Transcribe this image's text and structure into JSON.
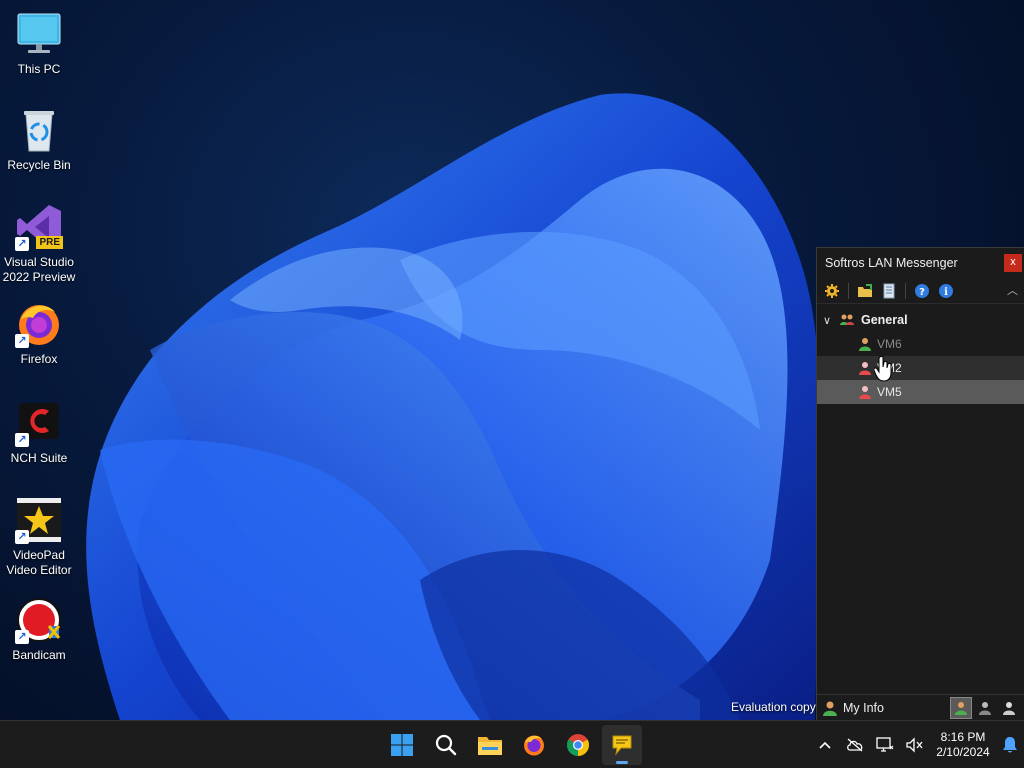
{
  "desktop": {
    "icons": [
      {
        "label": "This PC"
      },
      {
        "label": "Recycle Bin"
      },
      {
        "label": "Visual Studio 2022 Preview",
        "badge": "PRE"
      },
      {
        "label": "Firefox"
      },
      {
        "label": "NCH Suite"
      },
      {
        "label": "VideoPad Video Editor"
      },
      {
        "label": "Bandicam"
      }
    ],
    "evaluation_text": "Evaluation copy"
  },
  "messenger": {
    "title": "Softros LAN Messenger",
    "close_label": "x",
    "toolbar_icons": [
      "settings-icon",
      "send-files-icon",
      "message-log-icon",
      "help-icon",
      "info-icon"
    ],
    "groups": [
      {
        "label": "General",
        "contacts": [
          {
            "name": "VM6",
            "state": "offline"
          },
          {
            "name": "VM2",
            "state": "hover"
          },
          {
            "name": "VM5",
            "state": "selected"
          }
        ]
      }
    ],
    "my_info_label": "My Info",
    "accent": "#c42b1c"
  },
  "taskbar": {
    "apps": [
      "start-icon",
      "search-icon",
      "file-explorer-icon",
      "firefox-icon",
      "chrome-icon",
      "softros-messenger-icon"
    ],
    "clock": {
      "time": "8:16 PM",
      "date": "2/10/2024"
    }
  }
}
